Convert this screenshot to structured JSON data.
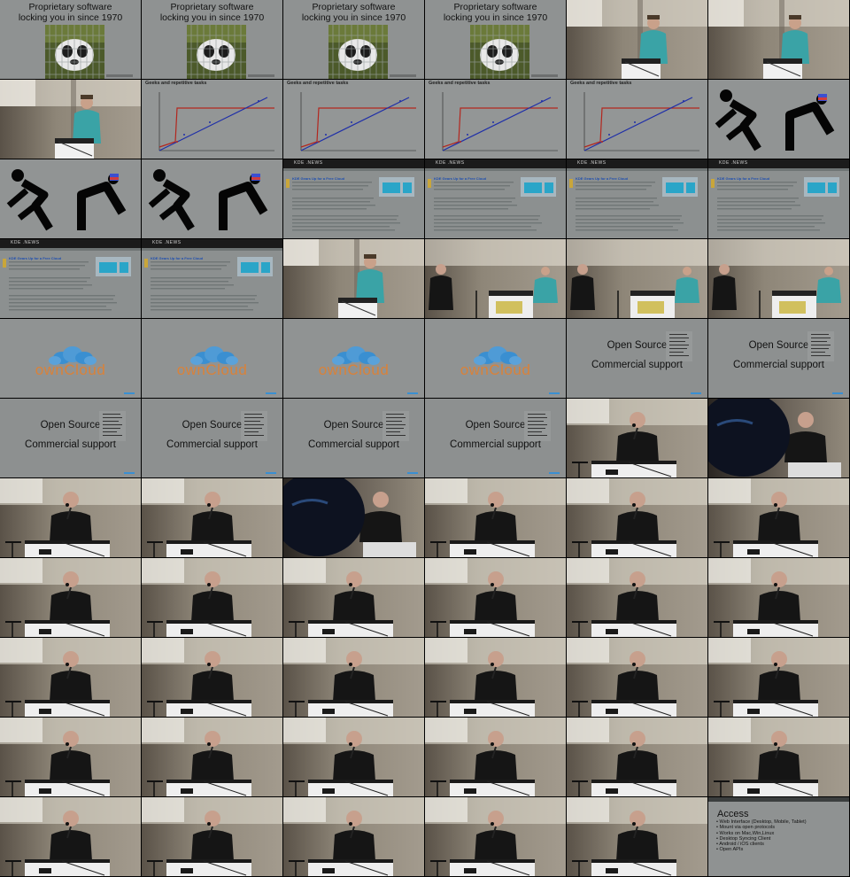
{
  "slides": {
    "proprietary": {
      "line1": "Proprietary software",
      "line2": "locking you in since 1970"
    },
    "geeks": {
      "title": "Geeks and repetitive tasks"
    },
    "kde_news": {
      "site": "KDE .NEWS",
      "headline": "KDE Gears Up for a Free Cloud"
    },
    "owncloud": {
      "logo_text": "ownCloud"
    },
    "open_source": {
      "line1": "Open Source",
      "line2": "Commercial support"
    },
    "access": {
      "title": "Access",
      "items": [
        "Web Interface (Desktop, Mobile, Tablet)",
        "Mount via open protocols",
        "Works on Mac,Win,Linux",
        "Desktop Syncing Client",
        "Android / iOS clients",
        "Open APIs"
      ]
    }
  },
  "colors": {
    "slide_gray": "#8f9292",
    "owncloud_orange": "#d9823a",
    "owncloud_blue": "#3a8fd1",
    "chart_red": "#b3261e",
    "chart_blue": "#1f2fa8",
    "shirt_teal": "#3aa3a6",
    "shirt_black": "#151515"
  }
}
